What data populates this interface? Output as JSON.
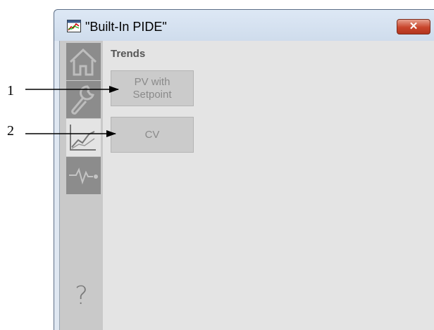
{
  "window": {
    "title": "\"Built-In PIDE\"",
    "close_glyph": "✕"
  },
  "sidebar": {
    "items": [
      {
        "name": "home",
        "icon": "home-icon"
      },
      {
        "name": "maintenance",
        "icon": "wrench-icon"
      },
      {
        "name": "trends",
        "icon": "trend-chart-icon",
        "active": true
      },
      {
        "name": "diagnostics",
        "icon": "pulse-icon"
      }
    ],
    "help_glyph": "?"
  },
  "trends": {
    "title": "Trends",
    "buttons": [
      {
        "label_line1": "PV with",
        "label_line2": "Setpoint"
      },
      {
        "label_line1": "CV",
        "label_line2": ""
      }
    ]
  },
  "callouts": [
    {
      "number": "1"
    },
    {
      "number": "2"
    }
  ],
  "colors": {
    "accent_close": "#c8452c",
    "nav_inactive": "#8c8c8c",
    "panel_bg": "#e4e4e4"
  }
}
